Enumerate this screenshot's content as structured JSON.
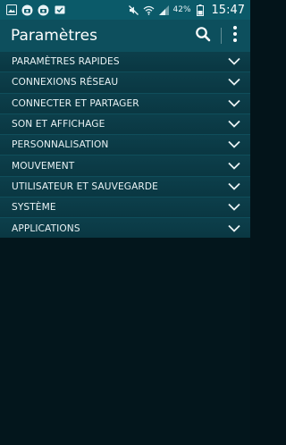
{
  "status_bar": {
    "icons_left": [
      "gallery-icon",
      "camera-icon",
      "camera-icon",
      "mail-icon"
    ],
    "icons_right": [
      "mute-icon",
      "wifi-icon",
      "signal-icon"
    ],
    "battery_percent": "42%",
    "time": "15:47"
  },
  "app_bar": {
    "title": "Paramètres",
    "search_icon": "search-icon",
    "more_icon": "more-vert-icon"
  },
  "categories": [
    {
      "label": "PARAMÈTRES RAPIDES"
    },
    {
      "label": "CONNEXIONS RÉSEAU"
    },
    {
      "label": "CONNECTER ET PARTAGER"
    },
    {
      "label": "SON ET AFFICHAGE"
    },
    {
      "label": "PERSONNALISATION"
    },
    {
      "label": "MOUVEMENT"
    },
    {
      "label": "UTILISATEUR ET SAUVEGARDE"
    },
    {
      "label": "SYSTÈME"
    },
    {
      "label": "APPLICATIONS"
    }
  ],
  "colors": {
    "status_bar": "#0b5a69",
    "app_bar": "#0d4f5d",
    "list_bg": "#0b3a45",
    "background": "#03161c"
  }
}
